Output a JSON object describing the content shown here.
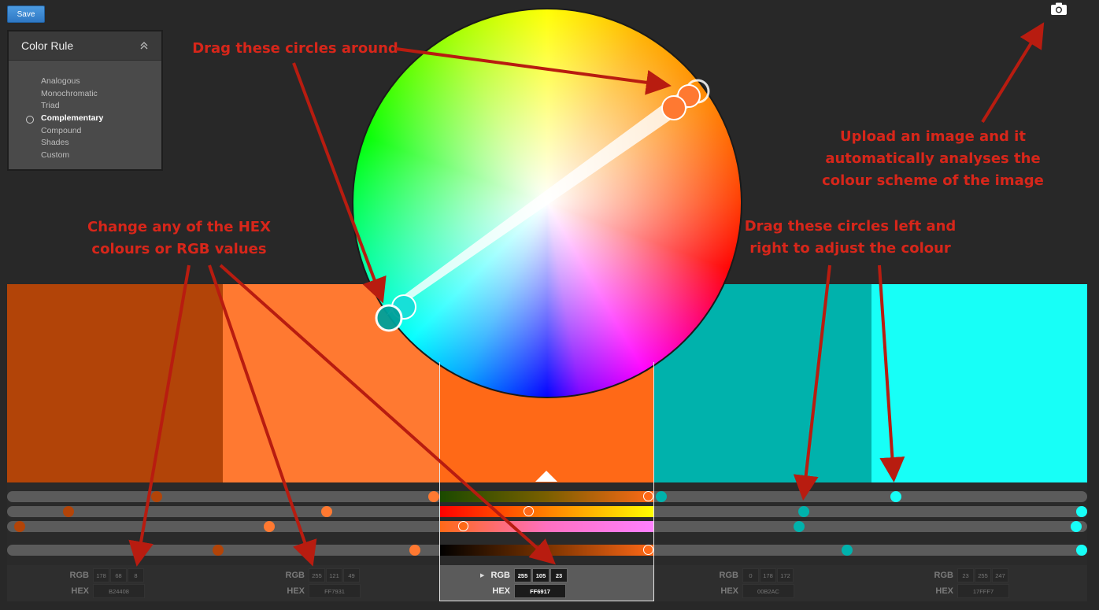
{
  "toolbar": {
    "save_label": "Save"
  },
  "color_rule": {
    "title": "Color Rule",
    "options": [
      "Analogous",
      "Monochromatic",
      "Triad",
      "Complementary",
      "Compound",
      "Shades",
      "Custom"
    ],
    "selected": "Complementary"
  },
  "swatches": [
    {
      "hex": "B24408",
      "rgb": [
        "178",
        "68",
        "8"
      ],
      "color": "#B24408"
    },
    {
      "hex": "FF7931",
      "rgb": [
        "255",
        "121",
        "49"
      ],
      "color": "#FF7931"
    },
    {
      "hex": "FF6917",
      "rgb": [
        "255",
        "105",
        "23"
      ],
      "color": "#FF6917",
      "base": true
    },
    {
      "hex": "00B2AC",
      "rgb": [
        "0",
        "178",
        "172"
      ],
      "color": "#00B2AC"
    },
    {
      "hex": "17FFF7",
      "rgb": [
        "23",
        "255",
        "247"
      ],
      "color": "#17FFF7"
    }
  ],
  "value_labels": {
    "rgb": "RGB",
    "hex": "HEX"
  },
  "annotations": {
    "drag_circles": "Drag these circles around",
    "upload_image": [
      "Upload an image and it",
      "automatically analyses the",
      "colour scheme of the image"
    ],
    "change_hex": [
      "Change any of the HEX",
      "colours or RGB values"
    ],
    "drag_left_right": [
      "Drag these circles left and",
      "right to adjust the colour"
    ]
  },
  "accent_color": "#d7261a"
}
